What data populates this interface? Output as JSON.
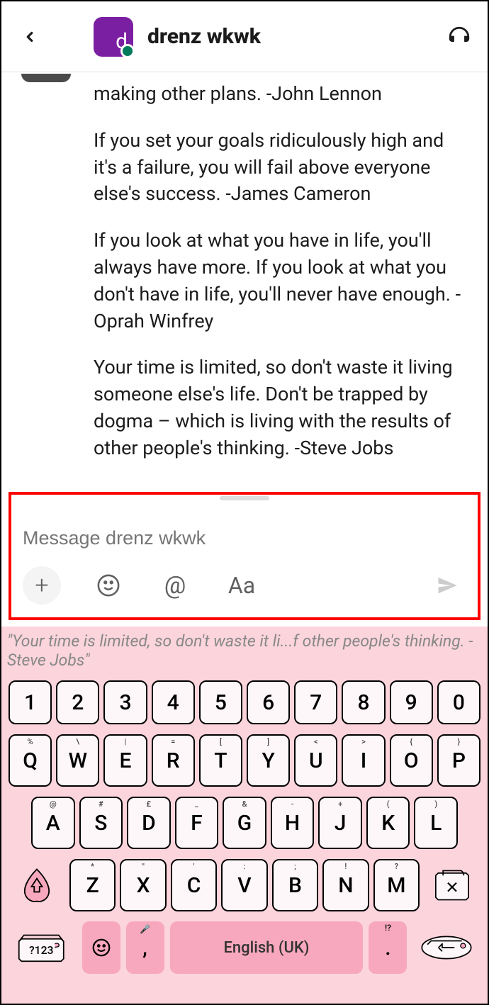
{
  "header": {
    "avatar_letter": "d",
    "title": "drenz wkwk"
  },
  "messages": [
    "making other plans. -John Lennon",
    "If you set your goals ridiculously high and it's a failure, you will fail above everyone else's success. -James Cameron",
    "If you look at what you have in life, you'll always have more. If you look at what you don't have in life, you'll never have enough. -Oprah Winfrey",
    "Your time is limited, so don't waste it living someone else's life. Don't be trapped by dogma – which is living with the results of other people's thinking.  -Steve Jobs"
  ],
  "composer": {
    "placeholder": "Message drenz wkwk"
  },
  "keyboard": {
    "suggestion": "\"Your time is limited, so don't waste it li...f other people's thinking. -Steve Jobs\"",
    "space_label": "English (UK)",
    "row_num": [
      "1",
      "2",
      "3",
      "4",
      "5",
      "6",
      "7",
      "8",
      "9",
      "0"
    ],
    "row_q": [
      {
        "m": "Q",
        "s": "%"
      },
      {
        "m": "W",
        "s": "\\"
      },
      {
        "m": "E",
        "s": "|"
      },
      {
        "m": "R",
        "s": "="
      },
      {
        "m": "T",
        "s": "["
      },
      {
        "m": "Y",
        "s": "]"
      },
      {
        "m": "U",
        "s": "<"
      },
      {
        "m": "I",
        "s": ">"
      },
      {
        "m": "O",
        "s": "{"
      },
      {
        "m": "P",
        "s": "}"
      }
    ],
    "row_a": [
      {
        "m": "A",
        "s": "@"
      },
      {
        "m": "S",
        "s": "#"
      },
      {
        "m": "D",
        "s": "£"
      },
      {
        "m": "F",
        "s": "_"
      },
      {
        "m": "G",
        "s": "&"
      },
      {
        "m": "H",
        "s": "-"
      },
      {
        "m": "J",
        "s": "+"
      },
      {
        "m": "K",
        "s": "("
      },
      {
        "m": "L",
        "s": ")"
      }
    ],
    "row_z": [
      {
        "m": "Z",
        "s": "*"
      },
      {
        "m": "X",
        "s": "\""
      },
      {
        "m": "C",
        "s": "'"
      },
      {
        "m": "V",
        "s": ":"
      },
      {
        "m": "B",
        "s": ";"
      },
      {
        "m": "N",
        "s": "!"
      },
      {
        "m": "M",
        "s": "?"
      }
    ],
    "symnum_label": "?123",
    "comma": ",",
    "period": ".",
    "period_sub": "!?"
  }
}
